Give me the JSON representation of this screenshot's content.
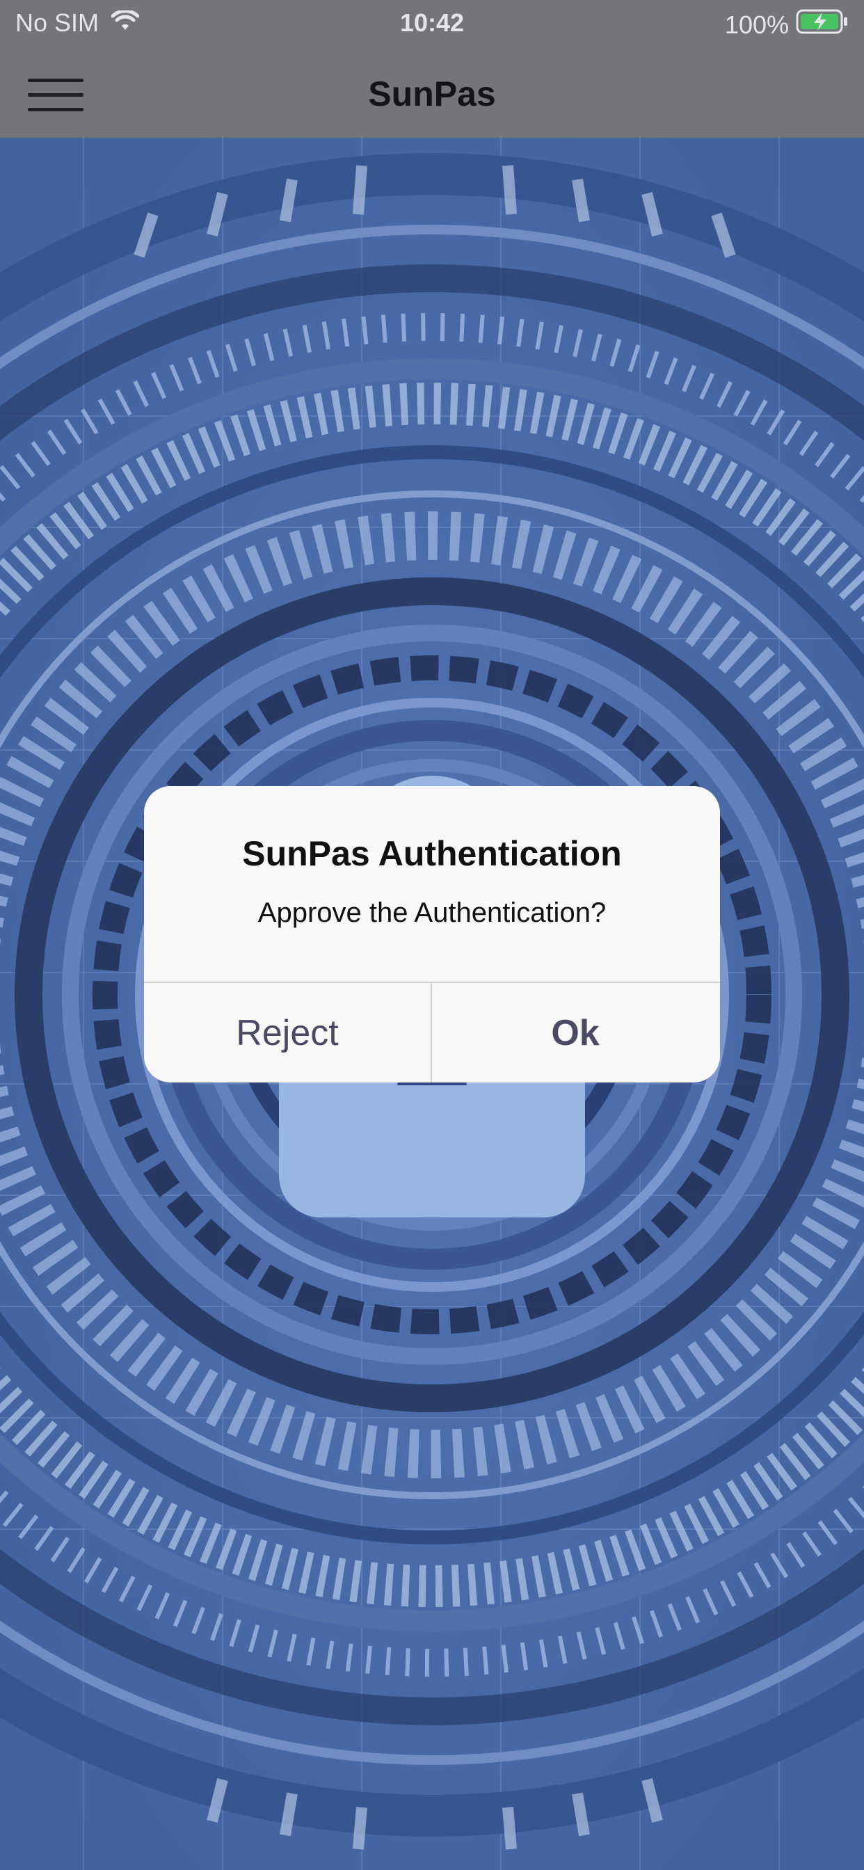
{
  "status_bar": {
    "carrier": "No SIM",
    "time": "10:42",
    "battery": "100%",
    "icons": [
      "wifi-icon",
      "battery-charging-icon"
    ]
  },
  "nav_bar": {
    "title": "SunPas",
    "menu_icon": "hamburger-menu-icon"
  },
  "background": {
    "description_icon": "security-lock-icon",
    "colors": {
      "base": "#4f6fae",
      "dark": "#2f3f6e",
      "light": "#a8c4f5"
    }
  },
  "alert": {
    "title": "SunPas Authentication",
    "message": "Approve the Authentication?",
    "reject_label": "Reject",
    "ok_label": "Ok"
  },
  "colors": {
    "bar_gray": "#7f7f7f",
    "alert_bg": "#f8f8f8",
    "button_text": "#4a4a63"
  }
}
